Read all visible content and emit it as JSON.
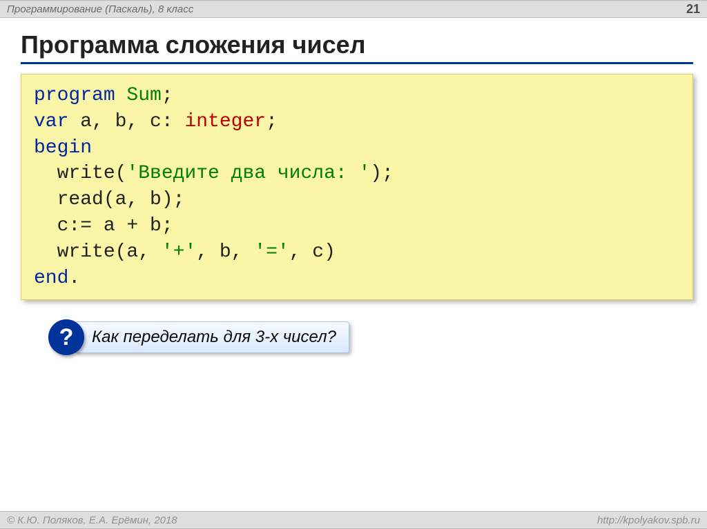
{
  "header": {
    "course": "Программирование (Паскаль), 8 класс",
    "page_number": "21"
  },
  "title": "Программа сложения чисел",
  "code": {
    "l1_kw": "program",
    "l1_name": " Sum",
    "l1_tail": ";",
    "l2_kw": "var",
    "l2_mid": " a, b, c: ",
    "l2_type": "integer",
    "l2_tail": ";",
    "l3": "begin",
    "l4_a": "  write(",
    "l4_str": "'Введите два числа: '",
    "l4_b": ");",
    "l5": "  read(a, b);",
    "l6": "  c:= a + b;",
    "l7_a": "  write(a, ",
    "l7_s1": "'+'",
    "l7_b": ", b, ",
    "l7_s2": "'='",
    "l7_c": ", c)",
    "l8_kw": "end",
    "l8_tail": "."
  },
  "question": {
    "mark": "?",
    "text": " Как переделать для 3-х чисел?"
  },
  "footer": {
    "copyright": "© К.Ю. Поляков, Е.А. Ерёмин, 2018",
    "url": "http://kpolyakov.spb.ru"
  }
}
